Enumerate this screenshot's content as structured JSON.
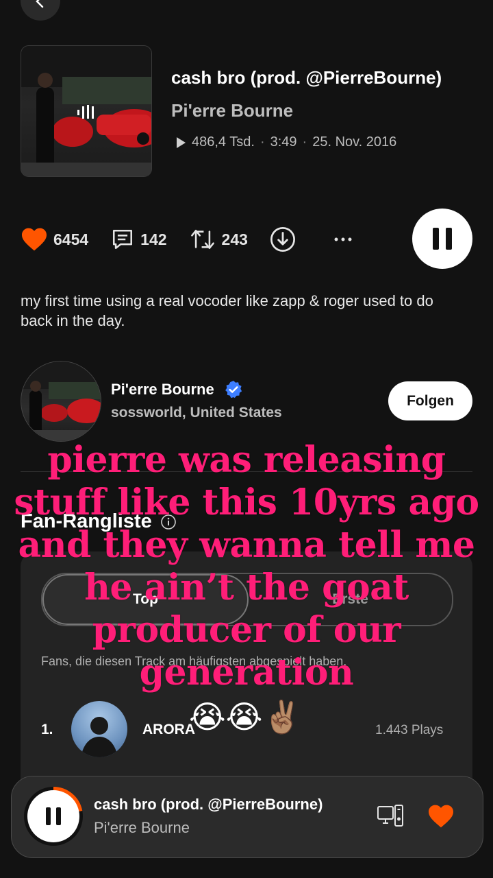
{
  "track": {
    "title": "cash bro (prod. @PierreBourne)",
    "artist": "Pi'erre Bourne",
    "plays": "486,4 Tsd.",
    "duration": "3:49",
    "date": "25. Nov. 2016"
  },
  "actions": {
    "likes": "6454",
    "comments": "142",
    "reposts": "243"
  },
  "description": "my first time using a real vocoder like zapp & roger used to do back in the day.",
  "profile": {
    "name": "Pi'erre Bourne",
    "location": "sossworld, United States",
    "follow_label": "Folgen"
  },
  "fans": {
    "title": "Fan-Rangliste",
    "tabs": [
      "Top",
      "Erste"
    ],
    "subtitle": "Fans, die diesen Track am häufigsten abgespielt haben.",
    "items": [
      {
        "rank": "1.",
        "name": "ARORA",
        "plays": "1.443 Plays"
      }
    ]
  },
  "overlay": {
    "caption": "pierre was releasing stuff like this 10yrs ago and they wanna tell me he ain’t the goat producer of our generation",
    "emojis": "😭😭✌🏽"
  },
  "mini_player": {
    "title": "cash bro (prod. @PierreBourne)",
    "artist": "Pi'erre Bourne",
    "progress": 0.22
  },
  "colors": {
    "accent": "#ff5500",
    "overlay_text": "#ff1e78",
    "verified": "#3d7eff"
  }
}
